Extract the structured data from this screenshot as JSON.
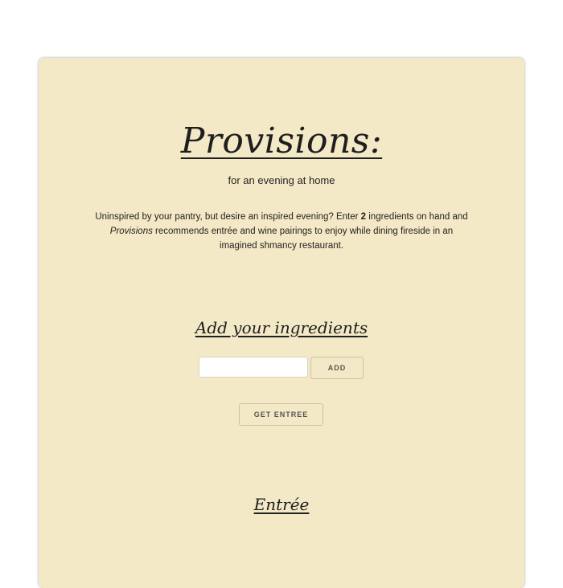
{
  "header": {
    "title": "Provisions:",
    "tagline": "for an evening at home",
    "intro": {
      "part1": "Uninspired by your pantry, but desire an inspired evening? Enter ",
      "count": "2",
      "part2": " ingredients on hand and ",
      "brand": "Provisions",
      "part3": " recommends entrée and wine pairings to enjoy while dining fireside in an imagined shmancy restaurant."
    }
  },
  "ingredients": {
    "heading": "Add your ingredients",
    "input_value": "",
    "add_label": "ADD"
  },
  "actions": {
    "get_entree_label": "GET ENTREE"
  },
  "entree": {
    "heading": "Entrée"
  },
  "colors": {
    "card_background": "#f4e9c6",
    "page_background": "#ffffff",
    "text": "#1c1c1c"
  }
}
